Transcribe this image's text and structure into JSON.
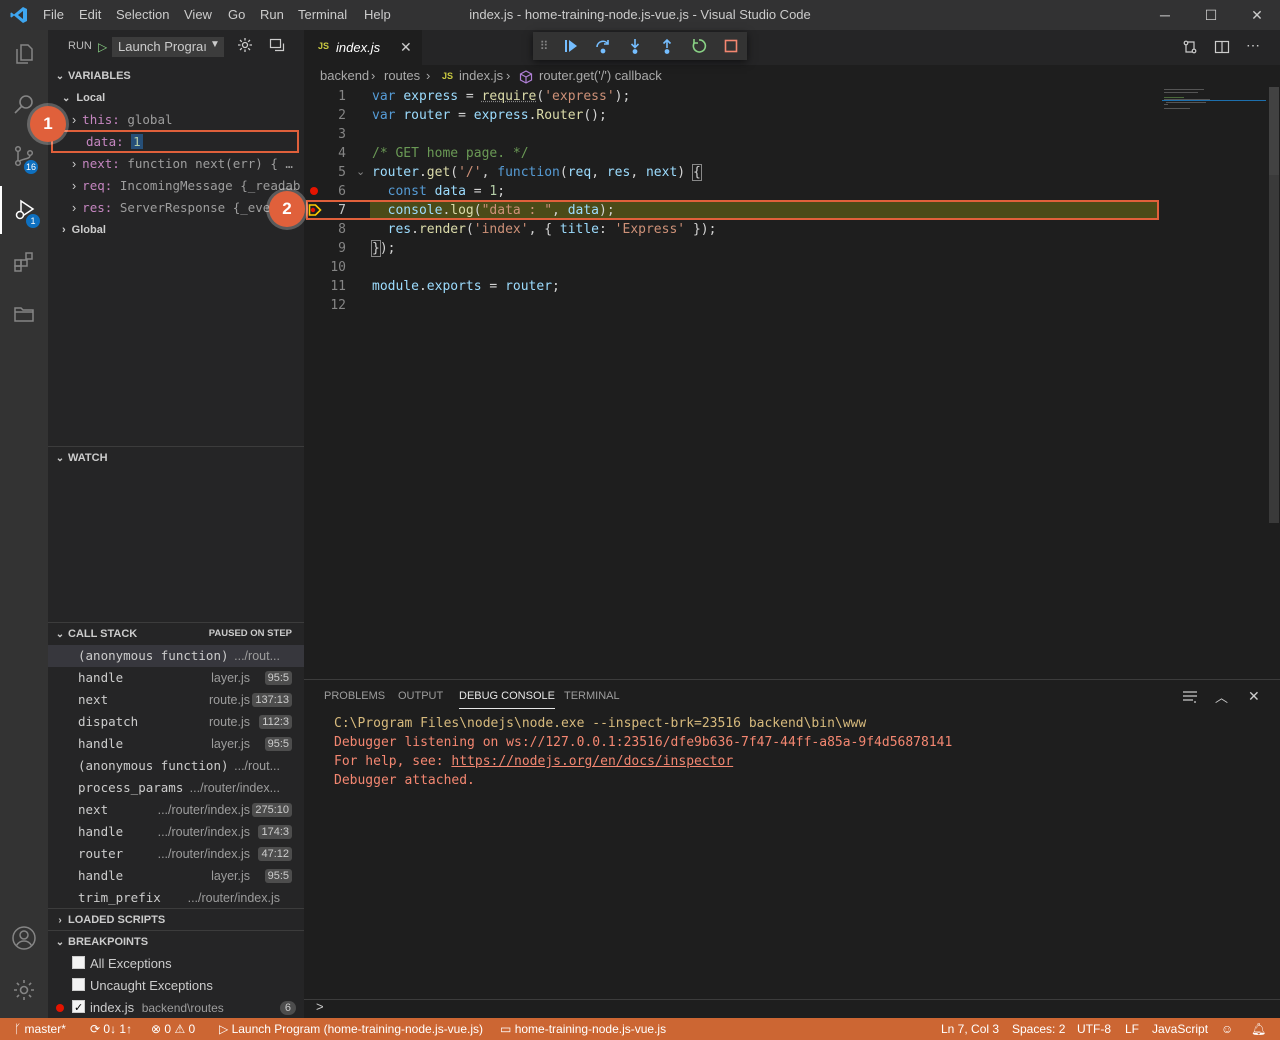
{
  "window": {
    "title": "index.js - home-training-node.js-vue.js - Visual Studio Code",
    "menu": [
      "File",
      "Edit",
      "Selection",
      "View",
      "Go",
      "Run",
      "Terminal",
      "Help"
    ],
    "minimize": "─",
    "maximize": "☐",
    "close": "✕"
  },
  "activity": {
    "source_control_badge": "16",
    "debug_badge": "1"
  },
  "run": {
    "label": "RUN",
    "config": "Launch Prograı"
  },
  "variables": {
    "header": "VARIABLES",
    "local_label": "Local",
    "items": [
      {
        "key": "this:",
        "value": "global"
      },
      {
        "key": "data:",
        "value": "1"
      },
      {
        "key": "next:",
        "value": "function next(err) { … }"
      },
      {
        "key": "req:",
        "value": "IncomingMessage {_readab…"
      },
      {
        "key": "res:",
        "value": "ServerResponse {_even…"
      }
    ],
    "global_label": "Global"
  },
  "watch": {
    "header": "WATCH"
  },
  "call_stack": {
    "header": "CALL STACK",
    "status": "PAUSED ON STEP",
    "frames": [
      {
        "fn": "(anonymous function)",
        "file": ".../rout...",
        "pos": ""
      },
      {
        "fn": "handle",
        "file": "layer.js",
        "pos": "95:5"
      },
      {
        "fn": "next",
        "file": "route.js",
        "pos": "137:13"
      },
      {
        "fn": "dispatch",
        "file": "route.js",
        "pos": "112:3"
      },
      {
        "fn": "handle",
        "file": "layer.js",
        "pos": "95:5"
      },
      {
        "fn": "(anonymous function)",
        "file": ".../rout...",
        "pos": ""
      },
      {
        "fn": "process_params",
        "file": ".../router/index...",
        "pos": ""
      },
      {
        "fn": "next",
        "file": ".../router/index.js",
        "pos": "275:10"
      },
      {
        "fn": "handle",
        "file": ".../router/index.js",
        "pos": "174:3"
      },
      {
        "fn": "router",
        "file": ".../router/index.js",
        "pos": "47:12"
      },
      {
        "fn": "handle",
        "file": "layer.js",
        "pos": "95:5"
      },
      {
        "fn": "trim_prefix",
        "file": ".../router/index.js",
        "pos": ""
      }
    ]
  },
  "loaded_scripts": {
    "header": "LOADED SCRIPTS"
  },
  "breakpoints": {
    "header": "BREAKPOINTS",
    "items": [
      {
        "label": "All Exceptions",
        "checked": false
      },
      {
        "label": "Uncaught Exceptions",
        "checked": false
      },
      {
        "label": "index.js",
        "path": "backend\\routes",
        "count": "6",
        "checked": true
      }
    ]
  },
  "editor": {
    "tab_label": "index.js",
    "tab_icon": "JS",
    "breadcrumb": [
      "backend",
      "routes",
      "index.js",
      "router.get('/') callback"
    ],
    "line_numbers": [
      "1",
      "2",
      "3",
      "4",
      "5",
      "6",
      "7",
      "8",
      "9",
      "10",
      "11",
      "12"
    ]
  },
  "panel": {
    "tabs": [
      "PROBLEMS",
      "OUTPUT",
      "DEBUG CONSOLE",
      "TERMINAL"
    ],
    "console": [
      {
        "text": "C:\\Program Files\\nodejs\\node.exe --inspect-brk=23516 backend\\bin\\www",
        "color": "#d7ba7d"
      },
      {
        "text": "Debugger listening on ws://127.0.0.1:23516/dfe9b636-7f47-44ff-a85a-9f4d56878141",
        "color": "#f48771"
      },
      {
        "prefix": "For help, see: ",
        "link": "https://nodejs.org/en/docs/inspector",
        "color": "#f48771"
      },
      {
        "text": "Debugger attached.",
        "color": "#f48771"
      }
    ],
    "prompt": ">"
  },
  "status": {
    "branch": "master*",
    "sync": "0↓ 1↑",
    "errors": "0",
    "warnings": "0",
    "launch": "Launch Program (home-training-node.js-vue.js)",
    "folder": "home-training-node.js-vue.js",
    "position": "Ln 7, Col 3",
    "spaces": "Spaces: 2",
    "encoding": "UTF-8",
    "eol": "LF",
    "language": "JavaScript"
  },
  "callouts": [
    "1",
    "2"
  ],
  "colors": {
    "statusbar": "#cc6633",
    "highlight": "#e0603b",
    "current_line": "#4b4b18"
  }
}
